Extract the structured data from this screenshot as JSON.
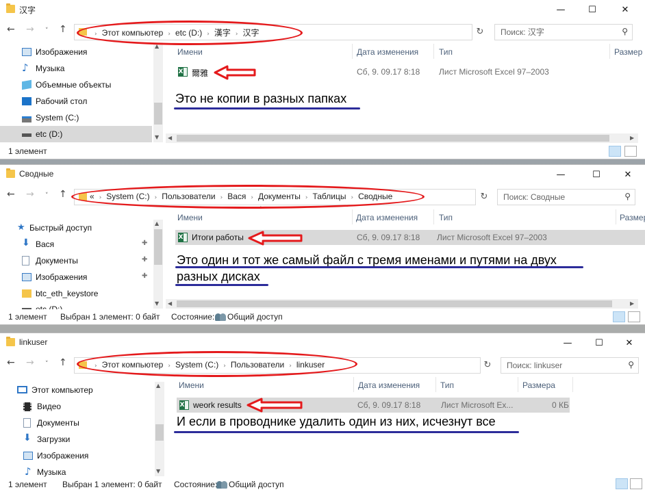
{
  "w1": {
    "title": "汉字",
    "crumbs": [
      "Этот компьютер",
      "etc (D:)",
      "漢字",
      "汉字"
    ],
    "search_placeholder": "Поиск: 汉字",
    "nav": [
      {
        "label": "Изображения",
        "icon": "pictures-icon"
      },
      {
        "label": "Музыка",
        "icon": "music-icon"
      },
      {
        "label": "Объемные объекты",
        "icon": "3d-objects-icon"
      },
      {
        "label": "Рабочий стол",
        "icon": "desktop-icon"
      },
      {
        "label": "System (C:)",
        "icon": "drive-icon"
      },
      {
        "label": "etc (D:)",
        "icon": "drive-icon"
      }
    ],
    "columns": {
      "name": "Имени",
      "date": "Дата изменения",
      "type": "Тип",
      "size": "Размер"
    },
    "file": {
      "name": "爾雅",
      "date": "Сб, 9. 09.17 8:18",
      "type": "Лист Microsoft Excel 97–2003"
    },
    "note": "Это не копии в разных папках",
    "status": {
      "count": "1 элемент"
    }
  },
  "w2": {
    "title": "Сводные",
    "crumbs": [
      "System (C:)",
      "Пользователи",
      "Вася",
      "Документы",
      "Таблицы",
      "Сводные"
    ],
    "overflow": "«",
    "search_placeholder": "Поиск: Сводные",
    "nav": [
      {
        "label": "Быстрый доступ",
        "icon": "star-icon"
      },
      {
        "label": "Вася",
        "icon": "download-icon"
      },
      {
        "label": "Документы",
        "icon": "documents-icon"
      },
      {
        "label": "Изображения",
        "icon": "pictures-icon"
      },
      {
        "label": "btc_eth_keystore",
        "icon": "folder-icon"
      },
      {
        "label": "etc (D:)",
        "icon": "drive-icon"
      }
    ],
    "columns": {
      "name": "Имени",
      "date": "Дата изменения",
      "type": "Тип",
      "size": "Размер"
    },
    "file": {
      "name": "Итоги работы",
      "date": "Сб, 9. 09.17 8:18",
      "type": "Лист Microsoft Excel 97–2003"
    },
    "note_line1": "Это один и тот же самый файл с тремя именами и путями на двух",
    "note_line2": "разных дисках",
    "status": {
      "count": "1 элемент",
      "selected": "Выбран 1 элемент: 0 байт",
      "state_label": "Состояние:",
      "state_value": "Общий доступ"
    }
  },
  "w3": {
    "title": "linkuser",
    "crumbs": [
      "Этот компьютер",
      "System (C:)",
      "Пользователи",
      "linkuser"
    ],
    "search_placeholder": "Поиск: linkuser",
    "nav": [
      {
        "label": "Этот компьютер",
        "icon": "computer-icon"
      },
      {
        "label": "Видео",
        "icon": "video-icon"
      },
      {
        "label": "Документы",
        "icon": "documents-icon"
      },
      {
        "label": "Загрузки",
        "icon": "download-icon"
      },
      {
        "label": "Изображения",
        "icon": "pictures-icon"
      },
      {
        "label": "Музыка",
        "icon": "music-icon"
      }
    ],
    "columns": {
      "name": "Имени",
      "date": "Дата изменения",
      "type": "Тип",
      "size": "Размера"
    },
    "file": {
      "name": "weork results",
      "date": "Сб, 9. 09.17 8:18",
      "type": "Лист Microsoft Ex...",
      "size": "0 КБ"
    },
    "note": "И если в проводнике удалить один из них, исчезнут все",
    "status": {
      "count": "1 элемент",
      "selected": "Выбран 1 элемент: 0 байт",
      "state_label": "Состояние:",
      "state_value": "Общий доступ"
    }
  },
  "icons": {
    "back": "←",
    "forward": "→",
    "recent": "˅",
    "up": "↑",
    "refresh": "↻",
    "search": "⚲",
    "minimize": "—",
    "maximize": "☐",
    "close": "✕",
    "chevron": "›",
    "pin": "📌",
    "expand": "^"
  },
  "colors": {
    "annotation_red": "#e41a1c",
    "annotation_underline": "#2c2c9a",
    "selection": "#d9d9d9"
  }
}
